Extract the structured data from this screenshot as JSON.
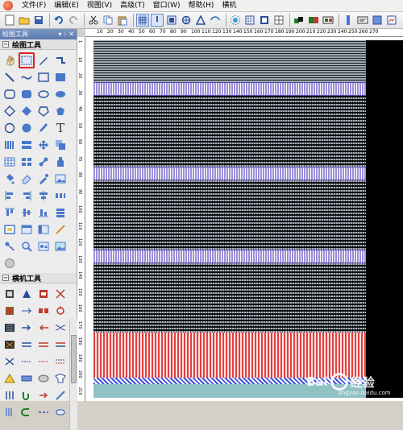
{
  "menu": [
    "文件(F)",
    "编辑(E)",
    "视图(V)",
    "高级(T)",
    "窗口(W)",
    "帮助(H)",
    "横机"
  ],
  "toolbar_icons": [
    "new-icon",
    "open-icon",
    "save-icon",
    "undo-icon",
    "redo-icon",
    "cut-icon",
    "copy-icon",
    "paste-icon",
    "grid-icon",
    "info-icon",
    "view-icon",
    "zoom-icon",
    "arrow-icon",
    "flip-icon",
    "settings-icon",
    "pattern-icon",
    "color-icon",
    "layout-icon"
  ],
  "panel_title": "绘图工具",
  "section_draw": "绘图工具",
  "section_machine": "横机工具",
  "ruler_h": [
    "10",
    "20",
    "30",
    "40",
    "50",
    "60",
    "70",
    "80",
    "90",
    "100",
    "110",
    "120",
    "130",
    "140",
    "150",
    "160",
    "170",
    "180",
    "190",
    "200",
    "210",
    "220",
    "230",
    "240",
    "250",
    "260",
    "270"
  ],
  "ruler_v": [
    "1",
    "10",
    "20",
    "30",
    "40",
    "50",
    "60",
    "70",
    "80",
    "90",
    "100",
    "110",
    "120",
    "130",
    "140",
    "150",
    "160",
    "170",
    "180",
    "190",
    "200",
    "210"
  ],
  "watermark": {
    "text": "Bai",
    "text2": "经验",
    "sub": "jingyan.baidu.com"
  }
}
